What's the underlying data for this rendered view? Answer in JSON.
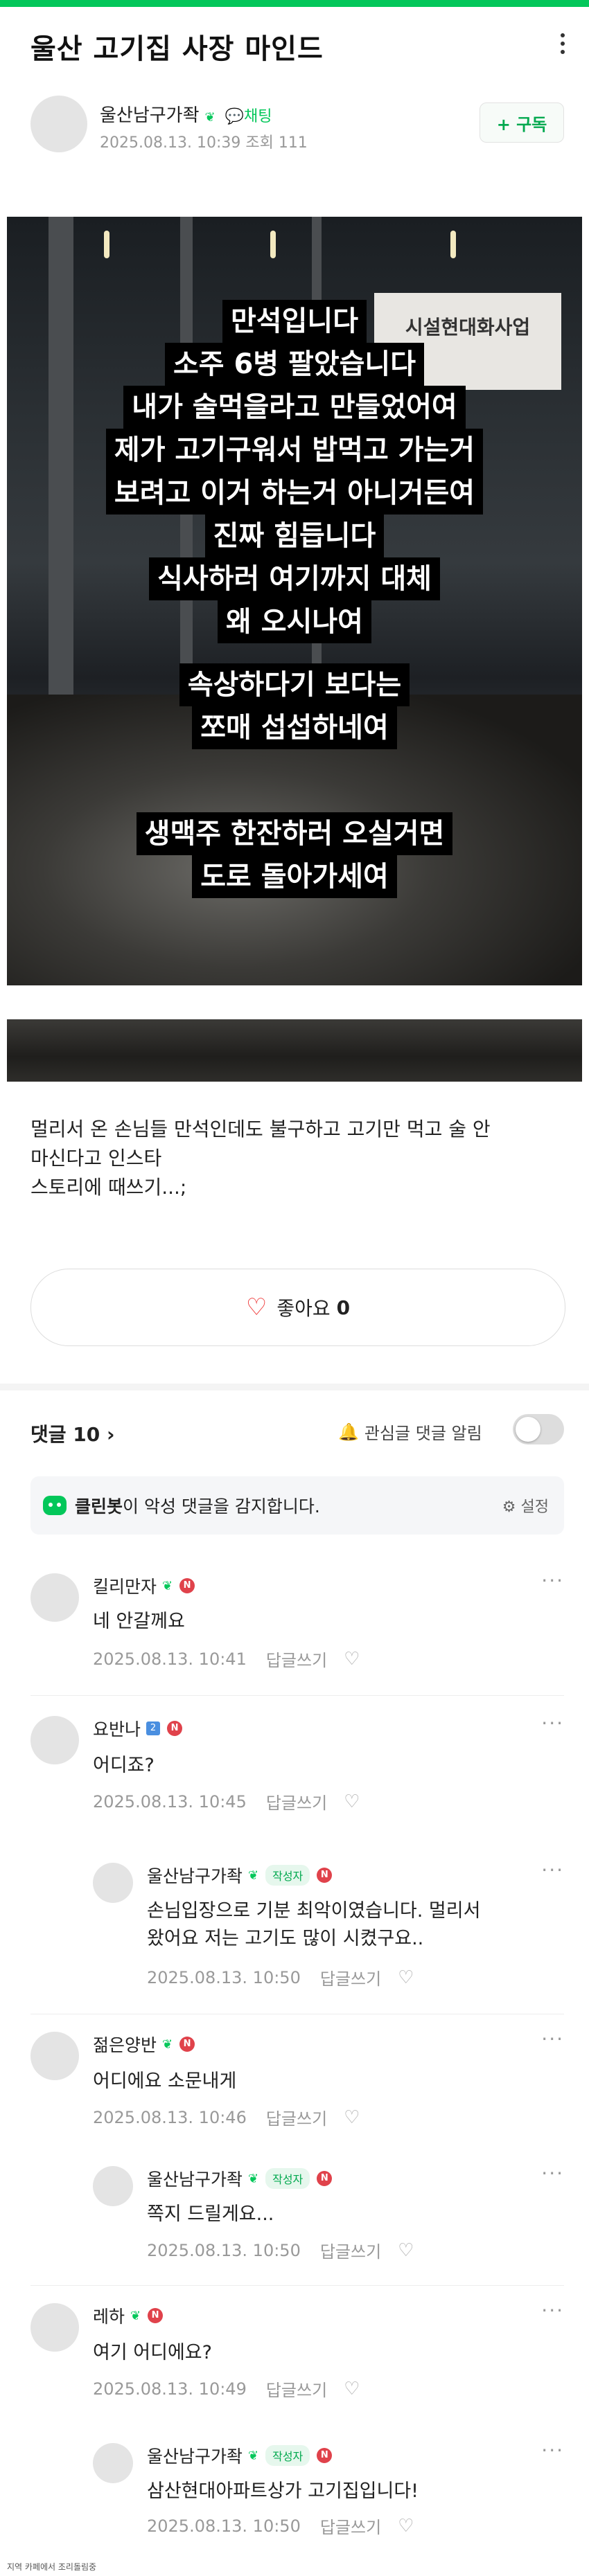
{
  "post": {
    "title": "울산 고기집 사장 마인드",
    "author": "울산남구가좍",
    "chat_label": "채팅",
    "meta": "2025.08.13. 10:39  조회 111",
    "subscribe_label": "+ 구독",
    "caption_lines_1": [
      "만석입니다",
      "소주 6병 팔았습니다",
      "내가 술먹을라고 만들었어여",
      "제가 고기구워서 밥먹고 가는거",
      "보려고 이거 하는거 아니거든여",
      "진짜 힘듭니다",
      "식사하러 여기까지 대체",
      "왜 오시나여"
    ],
    "caption_lines_2": [
      "속상하다기 보다는",
      "쪼매 섭섭하네여"
    ],
    "caption_lines_3": [
      "생맥주 한잔하러 오실거면",
      "도로 돌아가세여"
    ],
    "banner_text": "시설현대화사업",
    "body_line1": "멀리서 온 손님들 만석인데도 불구하고 고기만 먹고 술 안",
    "body_line2": "마신다고 인스타",
    "body_line3": "스토리에 때쓰기...;",
    "like_label": "좋아요",
    "like_count": "0"
  },
  "comments_header": {
    "label": "댓글 10",
    "alarm_label": "관심글 댓글 알림"
  },
  "cleanbot": {
    "name": "클린봇",
    "text": "이 악성 댓글을 감지합니다.",
    "settings": "설정"
  },
  "comments": [
    {
      "name": "킬리만자",
      "text": "네 안갈께요",
      "date": "2025.08.13. 10:41",
      "reply": "답글쓰기"
    },
    {
      "name": "요반나",
      "text": "어디죠?",
      "date": "2025.08.13. 10:45",
      "reply": "답글쓰기"
    },
    {
      "name": "울산남구가좍",
      "writer": "작성자",
      "text1": "손님입장으로 기분 최악이였습니다. 멀리서",
      "text2": "왔어요 저는 고기도 많이 시켰구요..",
      "date": "2025.08.13. 10:50",
      "reply": "답글쓰기"
    },
    {
      "name": "젊은양반",
      "text": "어디에요 소문내게",
      "date": "2025.08.13. 10:46",
      "reply": "답글쓰기"
    },
    {
      "name": "울산남구가좍",
      "writer": "작성자",
      "text": "쪽지 드릴게요...",
      "date": "2025.08.13. 10:50",
      "reply": "답글쓰기"
    },
    {
      "name": "레하",
      "text": "여기 어디에요?",
      "date": "2025.08.13. 10:49",
      "reply": "답글쓰기"
    },
    {
      "name": "울산남구가좍",
      "writer": "작성자",
      "text": "삼산현대아파트상가 고기집입니다!",
      "date": "2025.08.13. 10:50",
      "reply": "답글쓰기"
    }
  ],
  "footer": "지역 카페에서 조리돌림중",
  "colors": {
    "accent": "#03c75a",
    "heart": "#e33333",
    "badge": "#e0424b"
  }
}
